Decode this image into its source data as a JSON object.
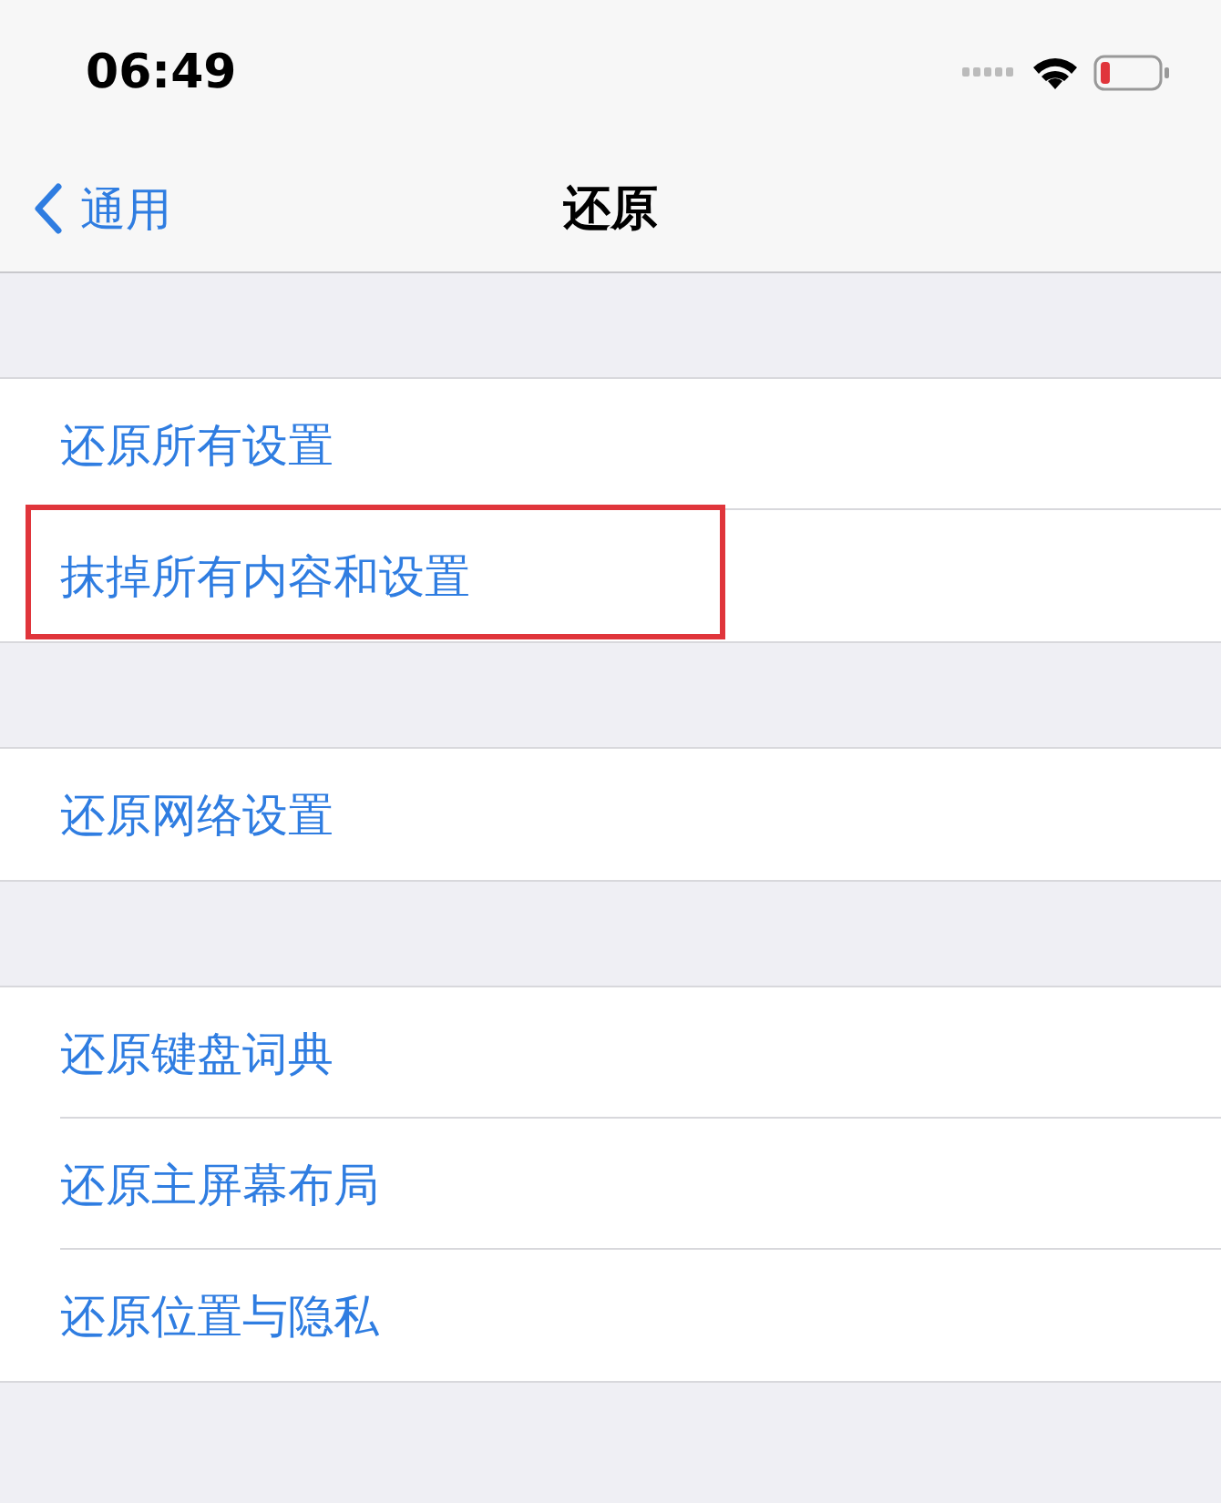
{
  "status_bar": {
    "time": "06:49"
  },
  "nav": {
    "back_label": "通用",
    "title": "还原"
  },
  "groups": [
    {
      "items": [
        {
          "label": "还原所有设置",
          "highlighted": false
        },
        {
          "label": "抹掉所有内容和设置",
          "highlighted": true
        }
      ]
    },
    {
      "items": [
        {
          "label": "还原网络设置",
          "highlighted": false
        }
      ]
    },
    {
      "items": [
        {
          "label": "还原键盘词典",
          "highlighted": false
        },
        {
          "label": "还原主屏幕布局",
          "highlighted": false
        },
        {
          "label": "还原位置与隐私",
          "highlighted": false
        }
      ]
    }
  ]
}
